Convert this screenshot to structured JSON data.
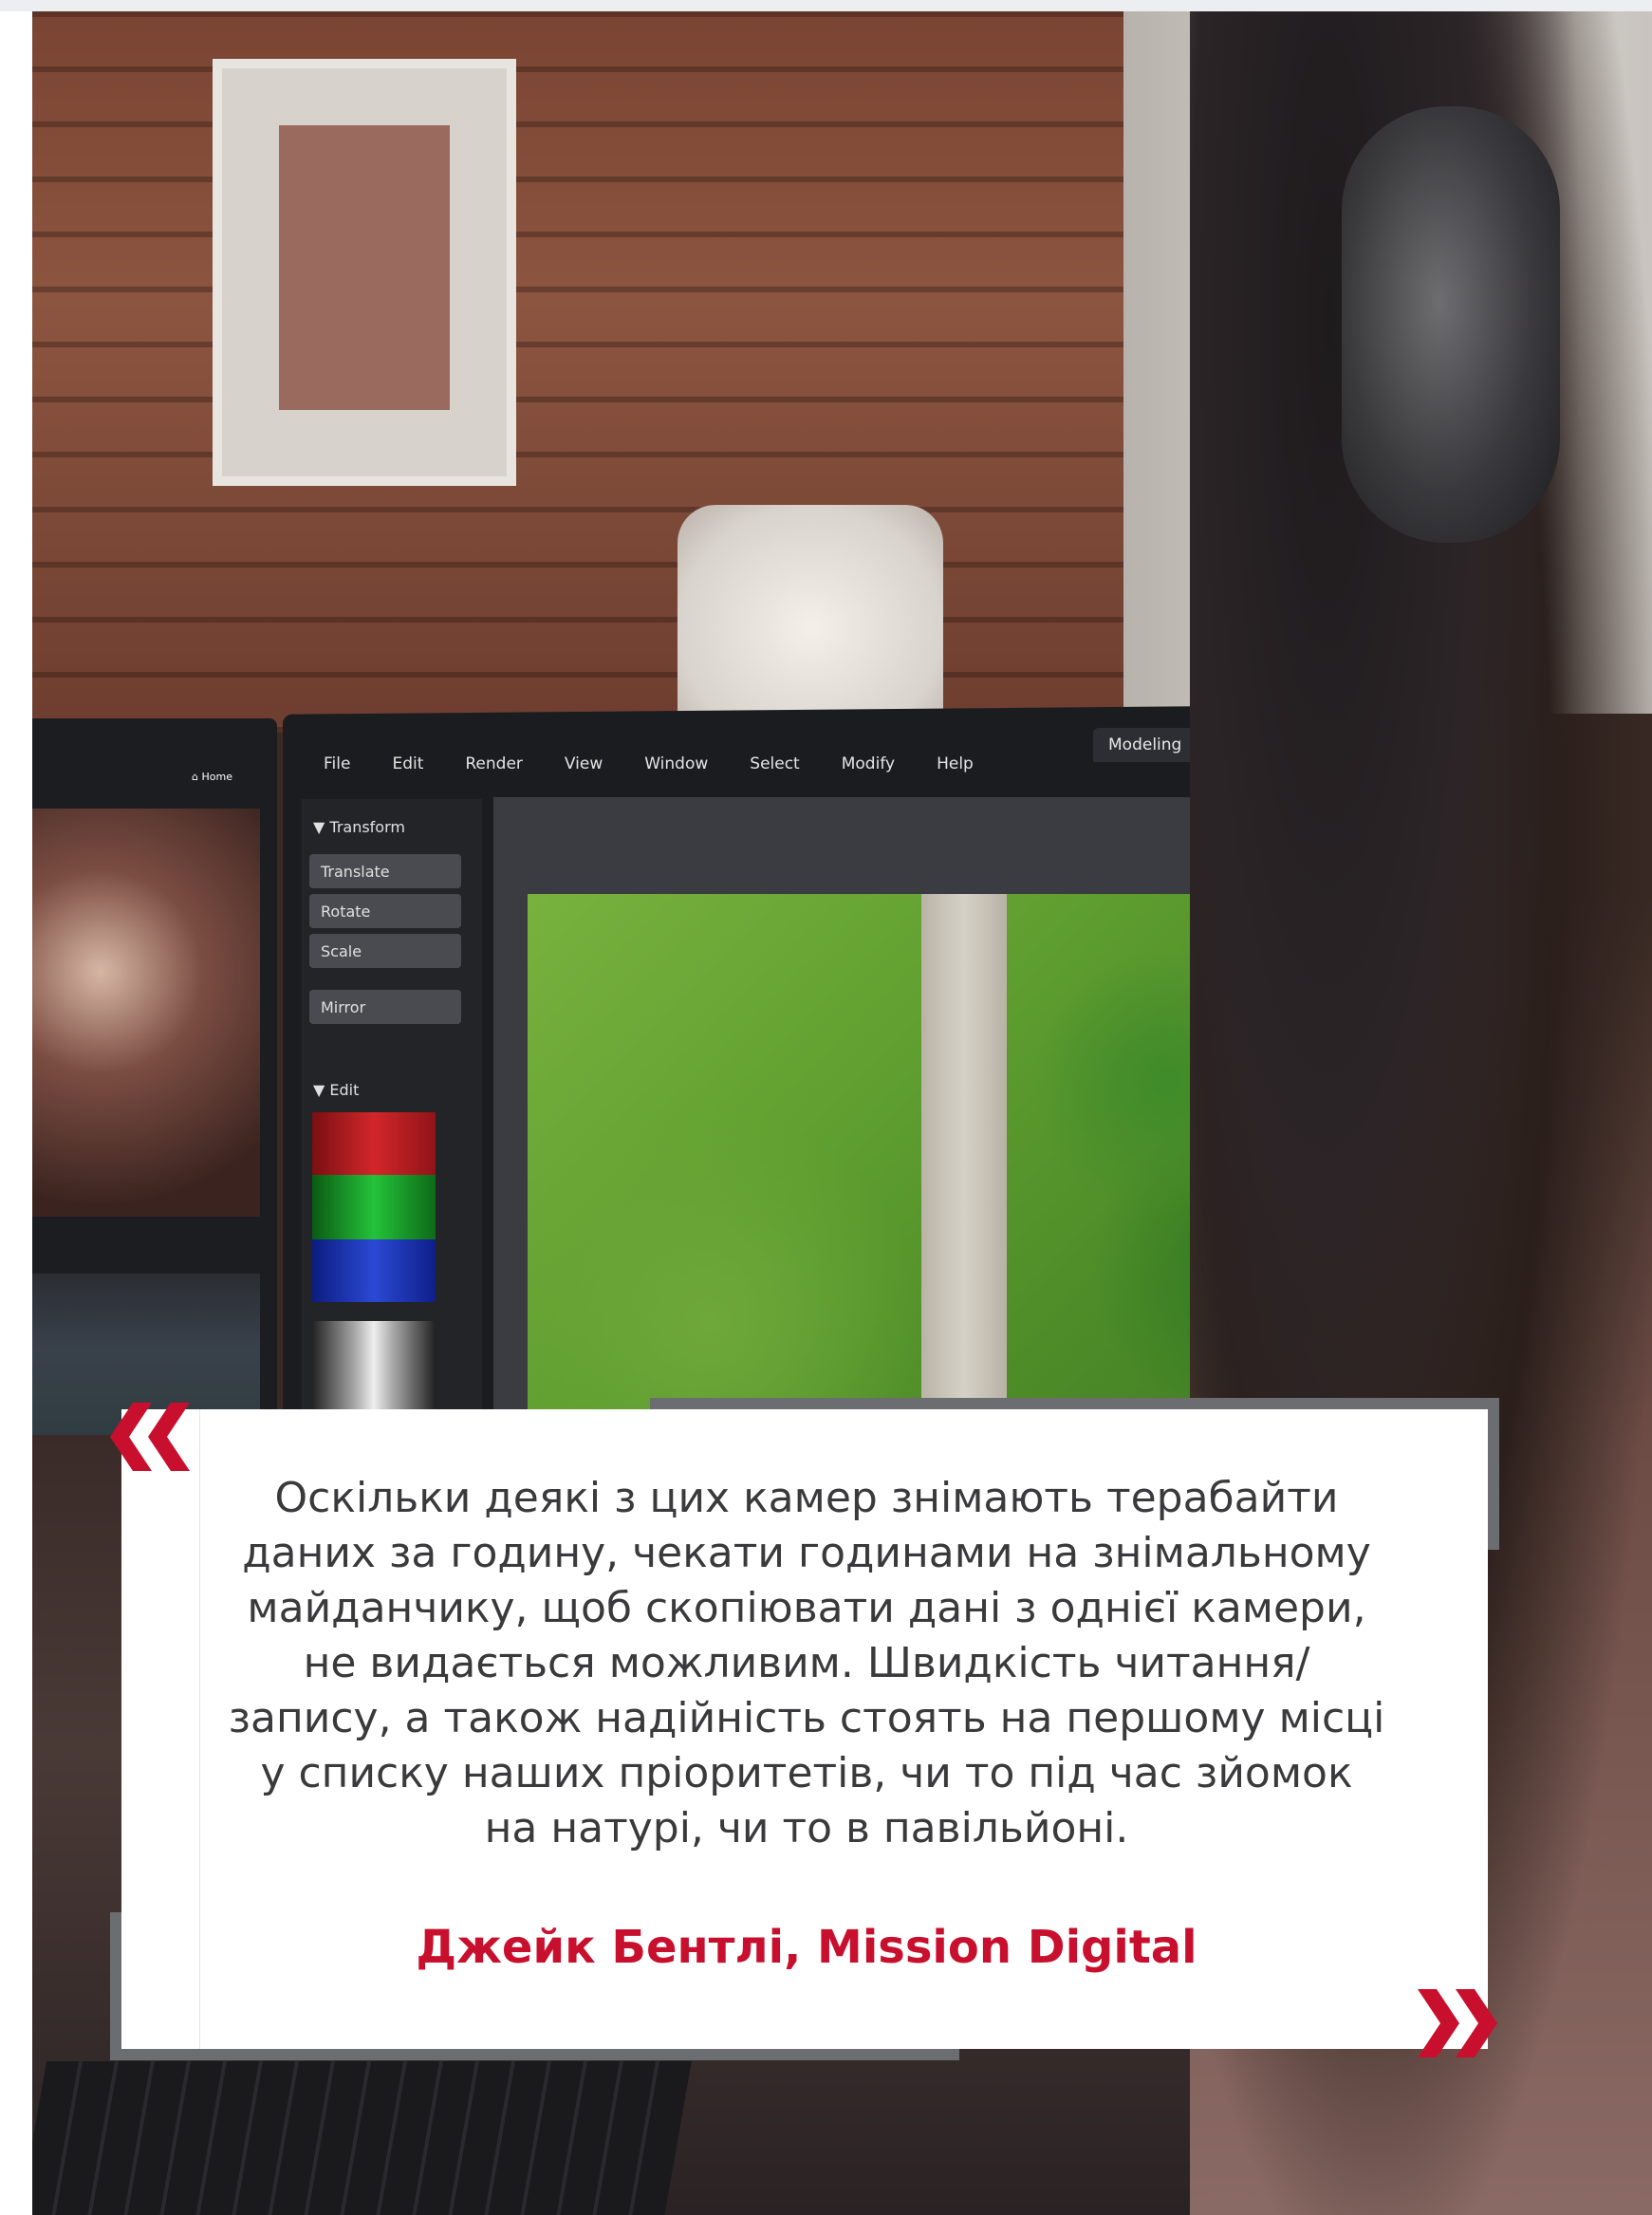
{
  "photo": {
    "left_monitor": {
      "home_label": "Home"
    },
    "monitor": {
      "menu": [
        "File",
        "Edit",
        "Render",
        "View",
        "Window",
        "Select",
        "Modify",
        "Help"
      ],
      "active_tab": "Modeling",
      "panel": {
        "transform_heading": "▼ Transform",
        "buttons": [
          "Translate",
          "Rotate",
          "Scale",
          "Mirror"
        ],
        "edit_heading": "▼ Edit"
      }
    }
  },
  "quote": {
    "text": "Оскільки деякі з цих камер знімають терабайти даних за годину, чекати годинами на знімальному майданчику, щоб скопіювати дані з однієї камери, не видається можливим. Швидкість читання/запису, а також надійність стоять на першому місці у списку наших пріоритетів, чи то під час зйомок на натурі, чи то в павільйоні.",
    "lines": [
      "Оскільки деякі з цих камер знімають терабайти",
      "даних за годину, чекати годинами на знімальному",
      "майданчику, щоб скопіювати дані з однієї камери,",
      "не видається можливим. Швидкість читання/",
      "запису, а також надійність стоять на першому місці",
      "у списку наших пріоритетів, чи то під час зйомок",
      "на натурі, чи то в павільйоні."
    ],
    "author": "Джейк Бентлі, Mission Digital"
  },
  "colors": {
    "accent": "#c8102e",
    "text": "#3a3a3c",
    "card_border": "#6b6d70",
    "card_bg": "#ffffff"
  }
}
